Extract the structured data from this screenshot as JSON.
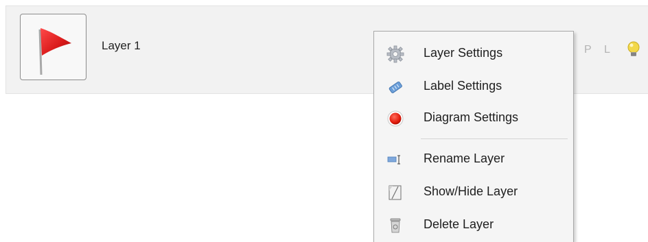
{
  "layer": {
    "name": "Layer 1",
    "status_p": "P",
    "status_l": "L",
    "flag_color": "#d91a1a",
    "bulb_color": "#f2d84a"
  },
  "context_menu": {
    "items": [
      {
        "label": "Layer Settings",
        "icon": "gear-icon"
      },
      {
        "label": "Label Settings",
        "icon": "label-tag-icon"
      },
      {
        "label": "Diagram Settings",
        "icon": "red-circle-icon"
      },
      {
        "label": "Rename Layer",
        "icon": "rename-icon"
      },
      {
        "label": "Show/Hide Layer",
        "icon": "visibility-toggle-icon"
      },
      {
        "label": "Delete Layer",
        "icon": "trash-icon"
      }
    ]
  }
}
